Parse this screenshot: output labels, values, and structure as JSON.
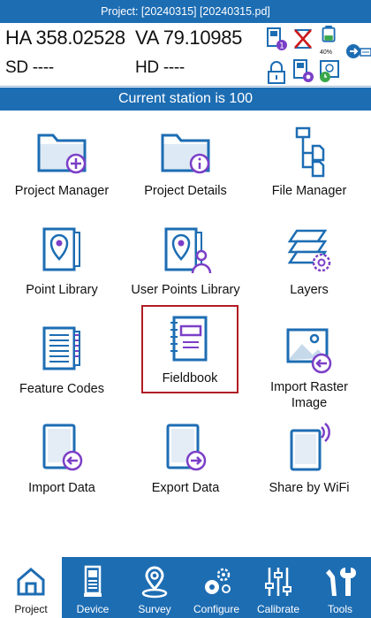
{
  "header": {
    "title": "Project: [20240315] [20240315.pd]"
  },
  "measurements": {
    "ha": "HA 358.02528",
    "va": "VA 79.10985",
    "sd": "SD ----",
    "hd": "HD ----",
    "battery": "40%"
  },
  "banner": {
    "text": "Current station is 100"
  },
  "tiles": [
    {
      "label": "Project Manager",
      "icon": "folder-add-icon"
    },
    {
      "label": "Project Details",
      "icon": "folder-info-icon"
    },
    {
      "label": "File Manager",
      "icon": "file-tree-icon"
    },
    {
      "label": "Point Library",
      "icon": "point-library-icon"
    },
    {
      "label": "User Points Library",
      "icon": "user-points-library-icon"
    },
    {
      "label": "Layers",
      "icon": "layers-gear-icon"
    },
    {
      "label": "Feature Codes",
      "icon": "feature-codes-book-icon"
    },
    {
      "label": "Fieldbook",
      "icon": "fieldbook-icon",
      "selected": true
    },
    {
      "label": "Import Raster Image",
      "icon": "image-import-icon"
    },
    {
      "label": "Import Data",
      "icon": "tablet-import-icon"
    },
    {
      "label": "Export Data",
      "icon": "tablet-export-icon"
    },
    {
      "label": "Share by WiFi",
      "icon": "tablet-wifi-icon"
    }
  ],
  "bottom_nav": [
    {
      "label": "Project",
      "icon": "home-icon",
      "active": true
    },
    {
      "label": "Device",
      "icon": "device-icon"
    },
    {
      "label": "Survey",
      "icon": "map-pin-icon"
    },
    {
      "label": "Configure",
      "icon": "gears-icon"
    },
    {
      "label": "Calibrate",
      "icon": "sliders-icon"
    },
    {
      "label": "Tools",
      "icon": "tools-icon"
    }
  ],
  "colors": {
    "brand_blue": "#1d6db3",
    "icon_blue": "#1d6db3",
    "selection_red": "#b01c24",
    "accent_purple": "#7b3fc7"
  }
}
